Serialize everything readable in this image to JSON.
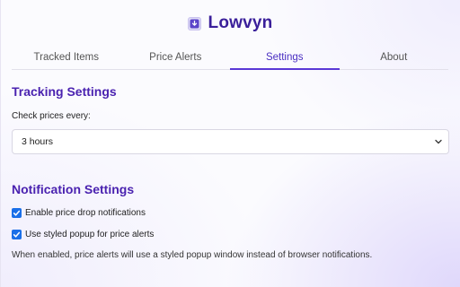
{
  "app": {
    "title": "Lowvyn",
    "logo_icon": "download-box-icon"
  },
  "tabs": [
    {
      "label": "Tracked Items",
      "active": false
    },
    {
      "label": "Price Alerts",
      "active": false
    },
    {
      "label": "Settings",
      "active": true
    },
    {
      "label": "About",
      "active": false
    }
  ],
  "tracking": {
    "heading": "Tracking Settings",
    "interval_label": "Check prices every:",
    "interval_value": "3 hours"
  },
  "notifications": {
    "heading": "Notification Settings",
    "options": [
      {
        "label": "Enable price drop notifications",
        "checked": true
      },
      {
        "label": "Use styled popup for price alerts",
        "checked": true
      }
    ],
    "note": "When enabled, price alerts will use a styled popup window instead of browser notifications."
  },
  "colors": {
    "accent": "#4a22b0",
    "tab_active": "#5a38d6",
    "checkbox": "#1a6fe8"
  }
}
